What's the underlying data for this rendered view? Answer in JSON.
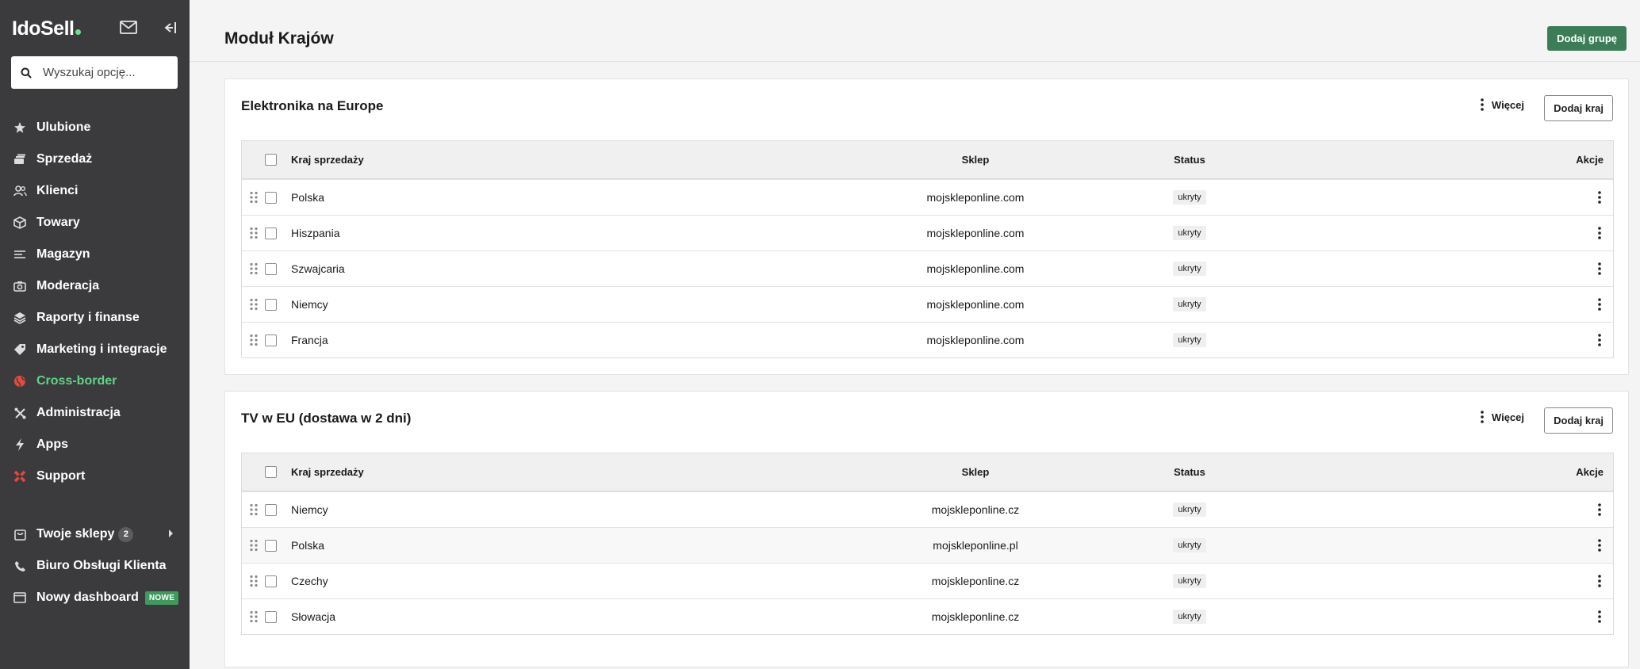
{
  "sidebar": {
    "logo": "IdoSell",
    "search_placeholder": "Wyszukaj opcję...",
    "items": [
      {
        "label": "Ulubione",
        "icon": "star-icon"
      },
      {
        "label": "Sprzedaż",
        "icon": "cash-icon"
      },
      {
        "label": "Klienci",
        "icon": "users-icon"
      },
      {
        "label": "Towary",
        "icon": "box-icon"
      },
      {
        "label": "Magazyn",
        "icon": "warehouse-icon"
      },
      {
        "label": "Moderacja",
        "icon": "camera-icon"
      },
      {
        "label": "Raporty i finanse",
        "icon": "layers-icon"
      },
      {
        "label": "Marketing i integracje",
        "icon": "tag-icon"
      },
      {
        "label": "Cross-border",
        "icon": "globe-icon"
      },
      {
        "label": "Administracja",
        "icon": "tools-icon"
      },
      {
        "label": "Apps",
        "icon": "bolt-icon"
      },
      {
        "label": "Support",
        "icon": "lifebuoy-icon"
      }
    ],
    "bottom": [
      {
        "label": "Twoje sklepy",
        "badge": "2",
        "icon": "bag-icon"
      },
      {
        "label": "Biuro Obsługi Klienta",
        "icon": "phone-icon"
      },
      {
        "label": "Nowy dashboard",
        "badge_new": "NOWE",
        "icon": "window-icon"
      }
    ]
  },
  "header": {
    "title": "Moduł Krajów",
    "add_group": "Dodaj grupę"
  },
  "columns": {
    "kraj": "Kraj sprzedaży",
    "sklep": "Sklep",
    "status": "Status",
    "akcje": "Akcje"
  },
  "groups": [
    {
      "title": "Elektronika na Europe",
      "more": "Więcej",
      "add_country": "Dodaj kraj",
      "rows": [
        {
          "kraj": "Polska",
          "sklep": "mojskleponline.com",
          "status": "ukryty"
        },
        {
          "kraj": "Hiszpania",
          "sklep": "mojskleponline.com",
          "status": "ukryty"
        },
        {
          "kraj": "Szwajcaria",
          "sklep": "mojskleponline.com",
          "status": "ukryty"
        },
        {
          "kraj": "Niemcy",
          "sklep": "mojskleponline.com",
          "status": "ukryty"
        },
        {
          "kraj": "Francja",
          "sklep": "mojskleponline.com",
          "status": "ukryty"
        }
      ]
    },
    {
      "title": "TV w EU (dostawa w 2 dni)",
      "more": "Więcej",
      "add_country": "Dodaj kraj",
      "rows": [
        {
          "kraj": "Niemcy",
          "sklep": "mojskleponline.cz",
          "status": "ukryty"
        },
        {
          "kraj": "Polska",
          "sklep": "mojskleponline.pl",
          "status": "ukryty"
        },
        {
          "kraj": "Czechy",
          "sklep": "mojskleponline.cz",
          "status": "ukryty"
        },
        {
          "kraj": "Słowacja",
          "sklep": "mojskleponline.cz",
          "status": "ukryty"
        }
      ]
    }
  ]
}
